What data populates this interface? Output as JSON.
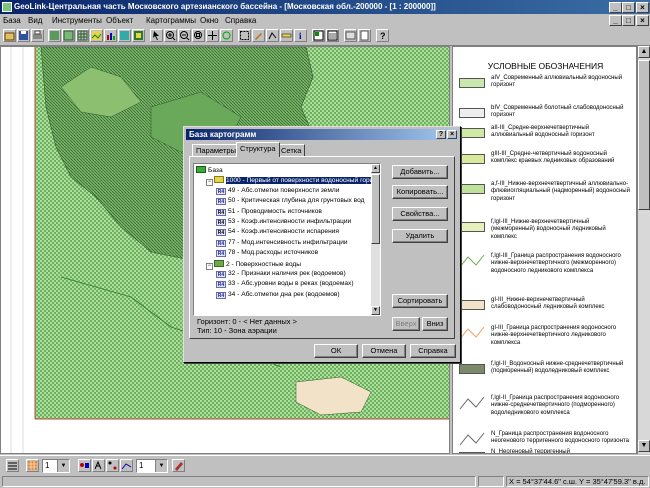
{
  "window": {
    "title": "GeoLink-Центральная часть Московского артезианского бассейна - [Московская обл.-200000 - [1 : 200000]]",
    "buttons": {
      "minimize": "_",
      "maximize": "□",
      "close": "×"
    }
  },
  "menu": [
    "База",
    "Вид",
    "Инструменты",
    "Объект",
    "Картограммы",
    "Окно",
    "Справка"
  ],
  "legend": {
    "title": "УСЛОВНЫЕ ОБОЗНАЧЕНИЯ",
    "items": [
      {
        "text": "aIV_Современный аллювиальный водоносный горизонт",
        "color": "#c9e8b0",
        "kind": "fill"
      },
      {
        "text": "bIV_Современный болотный слабоводоносный горизонт",
        "color": "#eeeeee",
        "kind": "fill"
      },
      {
        "text": "aII-III_Средне-верхнечетвертичный аллювиальный водоносный горизонт",
        "color": "#cfe9a4",
        "kind": "fill"
      },
      {
        "text": "gIII-III_Средне-четвертичный водоносный комплекс краевых ледниковых образований",
        "color": "#d8eb9c",
        "kind": "fill"
      },
      {
        "text": "a,f-III_Нижне-верхнечетвертичный аллювиально-флювиогляциальный (надморенный) водоносный горизонт",
        "color": "#bfe29a",
        "kind": "fill"
      },
      {
        "text": "f,lgI-III_Нижне-верхнечетвертичный (межморенный) водоносный ледниковый комплекс",
        "color": "#e6f0bc",
        "kind": "fill"
      },
      {
        "text": "f,lgI-III_Граница распространения водоносного нижне-верхнечетвертичного (межморенного) водоносного ледникового комплекса",
        "color": "#6ab04c",
        "kind": "line"
      },
      {
        "text": "gI-III_Нижне-верхнечетвертичный слабоводоносный ледниковый комплекс",
        "color": "#f2e2c8",
        "kind": "fill"
      },
      {
        "text": "gI-III_Граница распространения водоносного нижне-верхнечетвертичного ледникового комплекса",
        "color": "#e8a45a",
        "kind": "line"
      },
      {
        "text": "f,lgI-II_Водоносный нижне-среднечетвертичный (подморенный) водоледниковый комплекс",
        "color": "#7a8a6a",
        "kind": "fill"
      },
      {
        "text": "f,lgI-II_Граница распространения водоносного нижне-среднечетвертичного (подморенного) водоледникового комплекса",
        "color": "#666666",
        "kind": "line"
      },
      {
        "text": "N_Граница распространения водоносного неогенового терригенного водоносного горизонта",
        "color": "#666666",
        "kind": "line"
      },
      {
        "text": "N_Неогеновый терригенный",
        "color": "#e9e0c0",
        "kind": "fill"
      }
    ]
  },
  "dialog": {
    "title": "База картограмм",
    "tabs": [
      "Параметры",
      "Структура",
      "Сетка"
    ],
    "active_tab": "Структура",
    "tree": [
      {
        "label": "База",
        "icon": "base",
        "level": 0
      },
      {
        "label": "1000 - Первый от поверхности водоносный гори",
        "icon": "layer",
        "level": 1,
        "selected": true
      },
      {
        "label": "49 - Абс.отметки поверхности земли",
        "icon": "r4",
        "level": 2
      },
      {
        "label": "50 - Критическая глубина для грунтовых вод",
        "icon": "r4",
        "level": 2
      },
      {
        "label": "51 - Проводимость источников",
        "icon": "r4b",
        "level": 2
      },
      {
        "label": "53 - Коэф.интенсивности инфильтрации",
        "icon": "r4b",
        "level": 2
      },
      {
        "label": "54 - Коэф.интенсивности испарения",
        "icon": "r4b",
        "level": 2
      },
      {
        "label": "77 - Мод.интенсивность инфильтрации",
        "icon": "r4",
        "level": 2
      },
      {
        "label": "78 - Мод.расходы источников",
        "icon": "r4",
        "level": 2
      },
      {
        "label": "2 - Поверхностные воды",
        "icon": "group",
        "level": 1
      },
      {
        "label": "32 - Признаки наличия рек (водоемов)",
        "icon": "r4",
        "level": 2
      },
      {
        "label": "33 - Абс.уровни воды в реках (водоемах)",
        "icon": "r4",
        "level": 2
      },
      {
        "label": "34 - Абс.отметки дна рек (водоемов)",
        "icon": "r4",
        "level": 2
      }
    ],
    "side_buttons": {
      "add": "Добавить...",
      "copy": "Копировать...",
      "props": "Свойства...",
      "delete": "Удалить",
      "sort": "Сортировать",
      "up": "Вверх",
      "down": "Вниз"
    },
    "info": {
      "horizon": "Горизонт: 0 - < Нет данных >",
      "type": "Тип: 10 - Зона аэрации"
    },
    "buttons": {
      "ok": "ОК",
      "cancel": "Отмена",
      "help": "Справка"
    }
  },
  "bottombar": {
    "combo1": "1",
    "combo2": "1"
  },
  "status": {
    "coords": "X = 54°37'44.6\" с.ш. Y = 35°47'59.3\" в.д."
  }
}
